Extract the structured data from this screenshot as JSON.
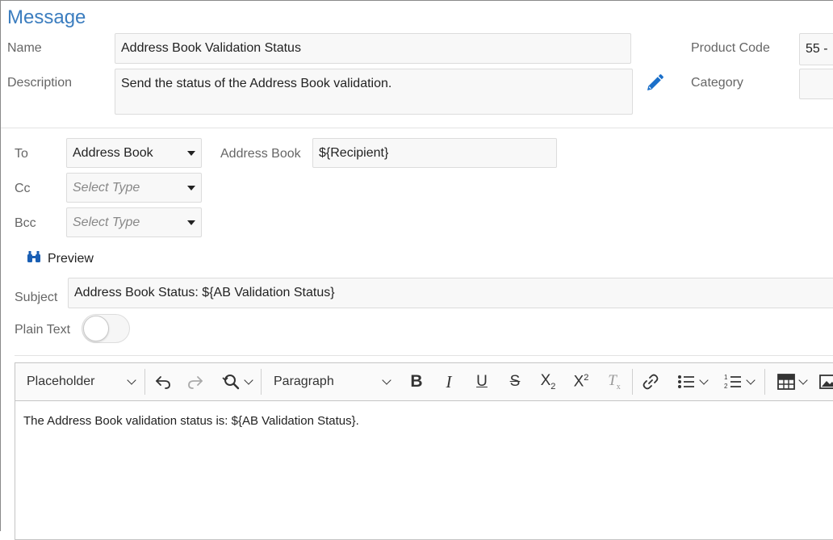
{
  "header": {
    "title": "Message"
  },
  "form": {
    "name_label": "Name",
    "name_value": "Address Book Validation Status",
    "description_label": "Description",
    "description_value": "Send the status of the Address Book validation.",
    "product_code_label": "Product Code",
    "product_code_value": "55 -",
    "category_label": "Category",
    "category_value": ""
  },
  "recipients": {
    "to_label": "To",
    "to_value": "Address Book",
    "address_book_label": "Address Book",
    "address_book_value": "${Recipient}",
    "cc_label": "Cc",
    "cc_placeholder": "Select Type",
    "bcc_label": "Bcc",
    "bcc_placeholder": "Select Type",
    "preview_label": "Preview"
  },
  "subject": {
    "label": "Subject",
    "value": "Address Book Status: ${AB Validation Status}"
  },
  "plain_text": {
    "label": "Plain Text",
    "enabled": false
  },
  "editor": {
    "placeholder_dropdown": "Placeholder",
    "heading_dropdown": "Paragraph",
    "content": "The Address Book validation status is: ${AB Validation Status}.",
    "icons": [
      "undo-icon",
      "redo-icon",
      "find-replace-icon",
      "bold-icon",
      "italic-icon",
      "underline-icon",
      "strikethrough-icon",
      "subscript-icon",
      "superscript-icon",
      "clear-format-icon",
      "link-icon",
      "bulleted-list-icon",
      "numbered-list-icon",
      "table-icon",
      "image-icon"
    ]
  },
  "colors": {
    "accent": "#3b7dbf",
    "edit_icon": "#1a6fc9"
  }
}
